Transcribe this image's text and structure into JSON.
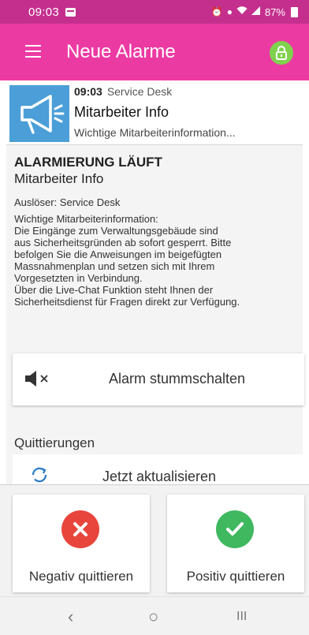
{
  "status_bar": {
    "time": "09:03",
    "battery": "87%",
    "icons": [
      "alarm-icon",
      "location-icon",
      "volte-icon",
      "wifi-icon",
      "signal-icon",
      "battery-icon"
    ]
  },
  "app_bar": {
    "title": "Neue Alarme",
    "menu_icon": "menu-icon",
    "lock_icon": "lock-icon",
    "lock_color": "#80d14e",
    "color": "#ec3aa3"
  },
  "notification": {
    "time": "09:03",
    "source": "Service Desk",
    "title": "Mitarbeiter Info",
    "preview": "Wichtige Mitarbeiterinformation...",
    "icon": "megaphone-icon",
    "icon_bg": "#4b9ed7"
  },
  "alarm": {
    "heading": "ALARMIERUNG LÄUFT",
    "subtitle": "Mitarbeiter Info",
    "trigger": "Auslöser: Service Desk",
    "message_lines": [
      "Wichtige Mitarbeiterinformation:",
      "Die Eingänge zum Verwaltungsgebäude sind",
      "aus Sicherheitsgründen ab sofort gesperrt. Bitte",
      "befolgen Sie die Anweisungen im beigefügten",
      "Massnahmenplan und setzen sich mit Ihrem",
      "Vorgesetzten in Verbindung.",
      "Über die Live-Chat Funktion steht Ihnen der",
      "Sicherheitsdienst für Fragen direkt zur Verfügung."
    ]
  },
  "mute": {
    "label": "Alarm stummschalten",
    "icon": "speaker-mute-icon"
  },
  "acknowledgements": {
    "section_title": "Quittierungen",
    "refresh_label": "Jetzt aktualisieren",
    "refresh_icon": "refresh-icon"
  },
  "actions": {
    "negative": {
      "label": "Negativ quittieren",
      "icon": "close-icon",
      "color": "#e8453c"
    },
    "positive": {
      "label": "Positiv quittieren",
      "icon": "check-icon",
      "color": "#3fb85f"
    }
  },
  "nav": {
    "back": "‹",
    "home": "○",
    "recents": "III"
  }
}
